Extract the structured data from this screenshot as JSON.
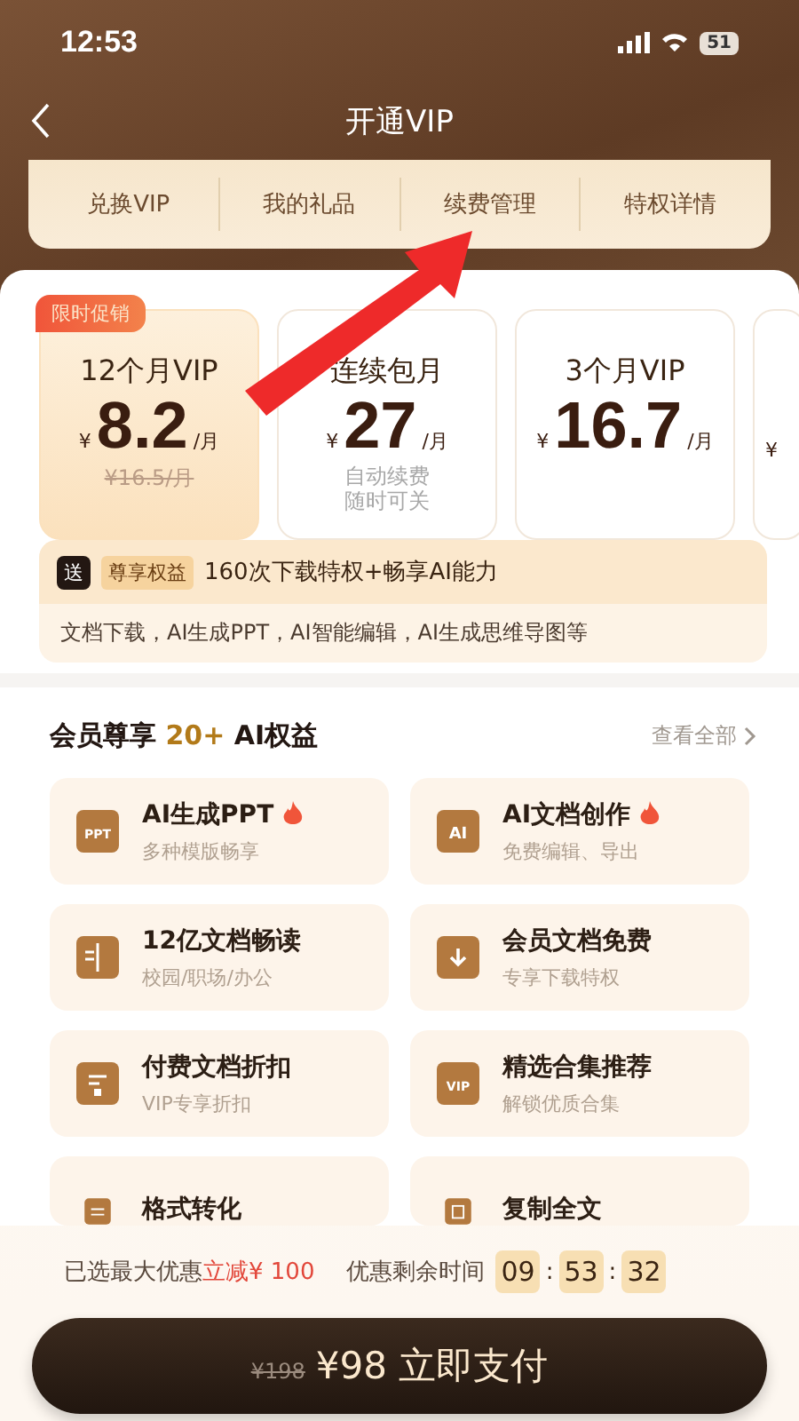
{
  "status_bar": {
    "time": "12:53",
    "battery": "51"
  },
  "nav": {
    "title": "开通VIP"
  },
  "tabs": [
    {
      "label": "兑换VIP",
      "selected": false
    },
    {
      "label": "我的礼品",
      "selected": false
    },
    {
      "label": "续费管理",
      "selected": false
    },
    {
      "label": "特权详情",
      "selected": false
    }
  ],
  "plans": [
    {
      "badge": "限时促销",
      "name": "12个月VIP",
      "currency": "¥",
      "price": "8.2",
      "unit": "/月",
      "original": "¥16.5/月",
      "selected": true
    },
    {
      "name": "连续包月",
      "currency": "¥",
      "price": "27",
      "unit": "/月",
      "note_lines": [
        "自动续费",
        "随时可关"
      ],
      "selected": false
    },
    {
      "name": "3个月VIP",
      "currency": "¥",
      "price": "16.7",
      "unit": "/月",
      "selected": false
    },
    {
      "currency": "¥",
      "selected": false
    }
  ],
  "benefit": {
    "icon_text": "送",
    "tag": "尊享权益",
    "headline": "160次下载特权+畅享AI能力",
    "detail": "文档下载，AI生成PPT，AI智能编辑，AI生成思维导图等"
  },
  "section": {
    "title_before": "会员尊享",
    "highlight": "20+",
    "title_after": "AI权益",
    "link": "查看全部"
  },
  "features": [
    {
      "kind": "ppt",
      "icon_label": "PPT",
      "title": "AI生成PPT",
      "subtitle": "多种模版畅享",
      "hot": true
    },
    {
      "kind": "ai",
      "icon_label": "AI",
      "title": "AI文档创作",
      "subtitle": "免费编辑、导出",
      "hot": true
    },
    {
      "kind": "book",
      "title": "12亿文档畅读",
      "subtitle": "校园/职场/办公",
      "hot": false
    },
    {
      "kind": "download",
      "title": "会员文档免费",
      "subtitle": "专享下载特权",
      "hot": false
    },
    {
      "kind": "doc",
      "title": "付费文档折扣",
      "subtitle": "VIP专享折扣",
      "hot": false
    },
    {
      "kind": "vip",
      "icon_label": "VIP",
      "title": "精选合集推荐",
      "subtitle": "解锁优质合集",
      "hot": false
    },
    {
      "kind": "convert",
      "title": "格式转化",
      "hot": false
    },
    {
      "kind": "copy",
      "title": "复制全文",
      "hot": false
    }
  ],
  "promo": {
    "text": "已选最大优惠",
    "highlight": "立减¥ 100",
    "timer_label": "优惠剩余时间",
    "timer": [
      "09",
      "53",
      "32"
    ],
    "timer_separator": ":"
  },
  "pay_button": {
    "original": "¥198",
    "label": "¥98 立即支付"
  }
}
